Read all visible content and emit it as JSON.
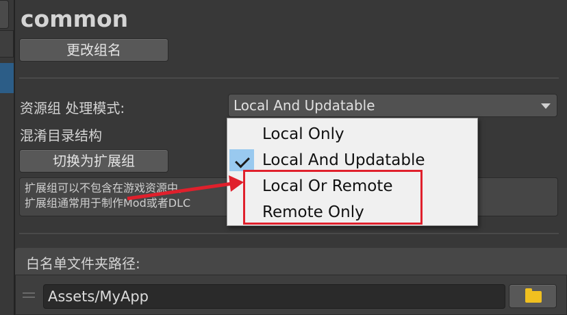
{
  "header": {
    "title": "common",
    "rename_button": "更改组名"
  },
  "settings": {
    "mode_label": "资源组 处理模式:",
    "mode_value": "Local And Updatable",
    "obfuscate_label": "混淆目录结构",
    "switch_button": "切换为扩展组",
    "help_line1": "扩展组可以不包含在游戏资源中，",
    "help_line2": "扩展组通常用于制作Mod或者DLC"
  },
  "dropdown_menu": {
    "items": [
      {
        "label": "Local Only",
        "checked": false
      },
      {
        "label": "Local And Updatable",
        "checked": true
      },
      {
        "label": "Local Or Remote",
        "checked": false
      },
      {
        "label": "Remote Only",
        "checked": false
      }
    ]
  },
  "whitelist": {
    "label": "白名单文件夹路径:",
    "path": "Assets/MyApp"
  },
  "colors": {
    "annotation": "#e0202c",
    "folder": "#f0c020",
    "selection": "#2c5d87",
    "check_bg": "#99c9ef"
  },
  "icons": {
    "folder": "folder-icon",
    "check": "check-icon",
    "caret": "chevron-down-icon",
    "drag": "drag-handle-icon",
    "arrow": "annotation-arrow"
  }
}
